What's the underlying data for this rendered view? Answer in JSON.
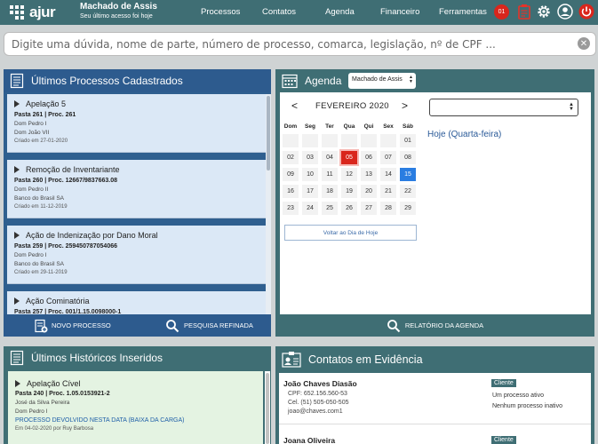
{
  "topbar": {
    "logo_text": "ajur",
    "user_name": "Machado de Assis",
    "user_subtitle": "Seu último acesso foi hoje",
    "nav": [
      "Processos",
      "Contatos",
      "Agenda",
      "Financeiro",
      "Ferramentas"
    ],
    "notifications": "01",
    "icons": [
      "clipboard-icon",
      "gear-icon",
      "user-icon",
      "power-icon"
    ]
  },
  "search": {
    "placeholder": "Digite uma dúvida, nome de parte, número de processo, comarca, legislação, nº de CPF ..."
  },
  "processos": {
    "title": "Últimos Processos Cadastrados",
    "items": [
      {
        "title": "Apelação 5",
        "ref": "Pasta 261 | Proc. 261",
        "line1": "Dom Pedro I",
        "line2": "Dom João VII",
        "date": "Criado em 27-01-2020"
      },
      {
        "title": "Remoção de Inventariante",
        "ref": "Pasta 260 | Proc. 12667/9837663.08",
        "line1": "Dom Pedro II",
        "line2": "Banco do Brasil SA",
        "date": "Criado em 11-12-2019"
      },
      {
        "title": "Ação de Indenização por Dano Moral",
        "ref": "Pasta 259 | Proc. 259450787054066",
        "line1": "Dom Pedro I",
        "line2": "Banco do Brasil SA",
        "date": "Criado em 29-11-2019"
      },
      {
        "title": "Ação Cominatória",
        "ref": "Pasta 257 | Proc. 001/1.15.0098000-1",
        "line1": "",
        "line2": "",
        "date": ""
      }
    ],
    "footer_new": "NOVO PROCESSO",
    "footer_search": "PESQUISA REFINADA"
  },
  "agenda": {
    "title": "Agenda",
    "user_select": "Machado de Assis",
    "month": "FEVEREIRO 2020",
    "prev": "<",
    "next": ">",
    "weekdays": [
      "Dom",
      "Seg",
      "Ter",
      "Qua",
      "Qui",
      "Sex",
      "Sáb"
    ],
    "weeks": [
      [
        "",
        "",
        "",
        "",
        "",
        "",
        "01"
      ],
      [
        "02",
        "03",
        "04",
        "05",
        "06",
        "07",
        "08"
      ],
      [
        "09",
        "10",
        "11",
        "12",
        "13",
        "14",
        "15"
      ],
      [
        "16",
        "17",
        "18",
        "19",
        "20",
        "21",
        "22"
      ],
      [
        "23",
        "24",
        "25",
        "26",
        "27",
        "28",
        "29"
      ]
    ],
    "today": "05",
    "selected": "15",
    "back_today": "Voltar ao Dia de Hoje",
    "day_label": "Hoje (Quarta-feira)",
    "footer": "RELATÓRIO DA AGENDA"
  },
  "historicos": {
    "title": "Últimos Históricos Inseridos",
    "item": {
      "title": "Apelação Cível",
      "ref": "Pasta 240 | Proc. 1.05.0153921-2",
      "line1": "José da Silva Pereira",
      "line2": "Dom Pedro I",
      "status": "PROCESSO DEVOLVIDO NESTA DATA (BAIXA DA CARGA)",
      "date": "Em 04-02-2020 por Ruy Barbosa"
    }
  },
  "contatos": {
    "title": "Contatos em Evidência",
    "items": [
      {
        "name": "João Chaves Diasão",
        "cpf": "CPF: 652.156.560-53",
        "cel": "Cel. (51) 505-050-505",
        "email": "joao@chaves.com1",
        "badge": "Cliente",
        "info1": "Um processo ativo",
        "info2": "Nenhum processo inativo"
      },
      {
        "name": "Joana Oliveira",
        "badge": "Cliente"
      }
    ]
  },
  "colors": {
    "teal": "#3f6e74",
    "blue": "#2d5b8e",
    "today": "#d9261c",
    "selected": "#2a7de1"
  }
}
